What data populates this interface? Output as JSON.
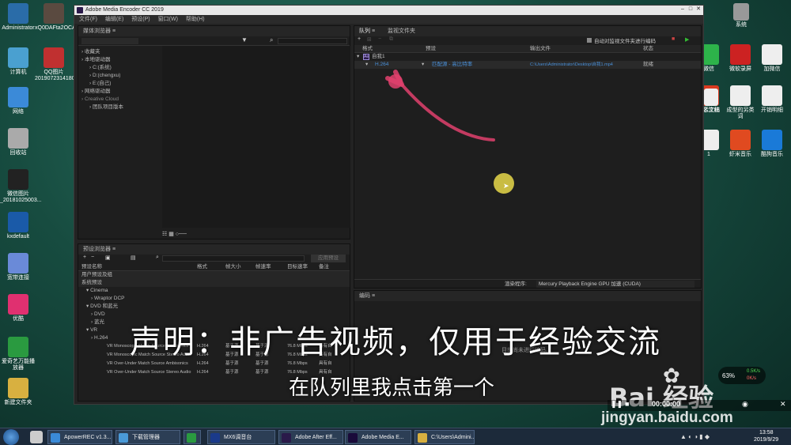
{
  "desktop": {
    "left_icons": [
      "Administrator",
      "计算机",
      "网络",
      "回收站",
      "微信图片_20181025003...",
      "kxdefault",
      "宽带连接",
      "优酷",
      "爱奇艺万能播放器",
      "新建文件夹"
    ],
    "second_col_icons": [
      "xQ0DAFta2OCAJ6ryAIf...",
      "QQ图片20190723141807"
    ],
    "right_icons": [
      "微信",
      "微软录屏",
      "加微信",
      "演示文稿",
      "成型的另类词",
      "开销明细",
      "1",
      "虾米音乐",
      "酷狗音乐"
    ],
    "right_partial_labels": [
      "系统",
      "名江红"
    ]
  },
  "window": {
    "title": "Adobe Media Encoder CC 2019",
    "menu": [
      "文件(F)",
      "编辑(E)",
      "预设(P)",
      "窗口(W)",
      "帮助(H)"
    ],
    "media_browser": {
      "title": "媒体浏览器",
      "search_icon": "search-icon",
      "tree": [
        "收藏夹",
        "本地驱动器",
        "C:(系统)",
        "D:(chengxu)",
        "E:(自己)",
        "网络驱动器",
        "Creative Cloud",
        "团队项目版本"
      ]
    },
    "queue": {
      "tab_queue": "队列",
      "tab_watch": "监视文件夹",
      "auto_encode": "自动对监视文件夹进行编码",
      "columns": [
        "格式",
        "预设",
        "输出文件",
        "状态"
      ],
      "group": "自我1",
      "item": {
        "format": "H.264",
        "preset": "匹配源 - 高比特率",
        "output": "C:\\Users\\Administrator\\Desktop\\自我1.mp4",
        "status": "就绪"
      },
      "renderer_label": "渲染程序:",
      "renderer_value": "Mercury Playback Engine GPU 加速 (CUDA)"
    },
    "preset_browser": {
      "title": "预设浏览器",
      "apply_button": "应用预设",
      "columns": [
        "预设名称",
        "格式",
        "帧大小",
        "帧速率",
        "目标速率",
        "备注"
      ],
      "groups": [
        "用户预设及组",
        "系统预设"
      ],
      "items": [
        {
          "name": "Cinema",
          "type": "folder"
        },
        {
          "name": "Wraptor DCP",
          "type": "sub"
        },
        {
          "name": "DVD 和蓝光",
          "type": "folder"
        },
        {
          "name": "DVD",
          "type": "sub"
        },
        {
          "name": "蓝光",
          "type": "sub"
        },
        {
          "name": "VR",
          "type": "folder"
        },
        {
          "name": "H.264",
          "type": "sub"
        }
      ],
      "rows": [
        {
          "name": "VR Monoscopic Match Source Ambisonics",
          "format": "H.264",
          "frame": "基于源",
          "rate": "基于源",
          "target": "76.8 Mbps",
          "note": "具有自"
        },
        {
          "name": "VR Monoscopic Match Source Stereo Audio",
          "format": "H.264",
          "frame": "基于源",
          "rate": "基于源",
          "target": "76.8 Mbps",
          "note": "具有自"
        },
        {
          "name": "VR Over-Under Match Source Ambisonics",
          "format": "H.264",
          "frame": "基于源",
          "rate": "基于源",
          "target": "76.8 Mbps",
          "note": "具有自"
        },
        {
          "name": "VR Over-Under Match Source Stereo Audio",
          "format": "H.264",
          "frame": "基于源",
          "rate": "基于源",
          "target": "76.8 Mbps",
          "note": "具有自"
        }
      ]
    },
    "encoding": {
      "title": "编码",
      "idle": "目前尚未进行编码。"
    }
  },
  "subtitles": {
    "disclaimer": "声明：非广告视频，仅用于经验交流",
    "caption": "在队列里我点击第一个"
  },
  "watermark": {
    "brand": "Bai 经验",
    "url": "jingyan.baidu.com"
  },
  "player": {
    "time": "00:00:00",
    "percent": "63%",
    "speed_up": "0.5K/s",
    "speed_down": "0K/s"
  },
  "taskbar": {
    "items": [
      "ApowerREC v1.3...",
      "下载管理器",
      "",
      "MX6调音台",
      "Adobe After Eff...",
      "Adobe Media E...",
      "C:\\Users\\Admini..."
    ],
    "clock_time": "13:58",
    "clock_date": "2019/9/29"
  },
  "colors": {
    "accent": "#4a90d9",
    "arrow": "#e0416d",
    "cursor": "#e8d84a"
  }
}
